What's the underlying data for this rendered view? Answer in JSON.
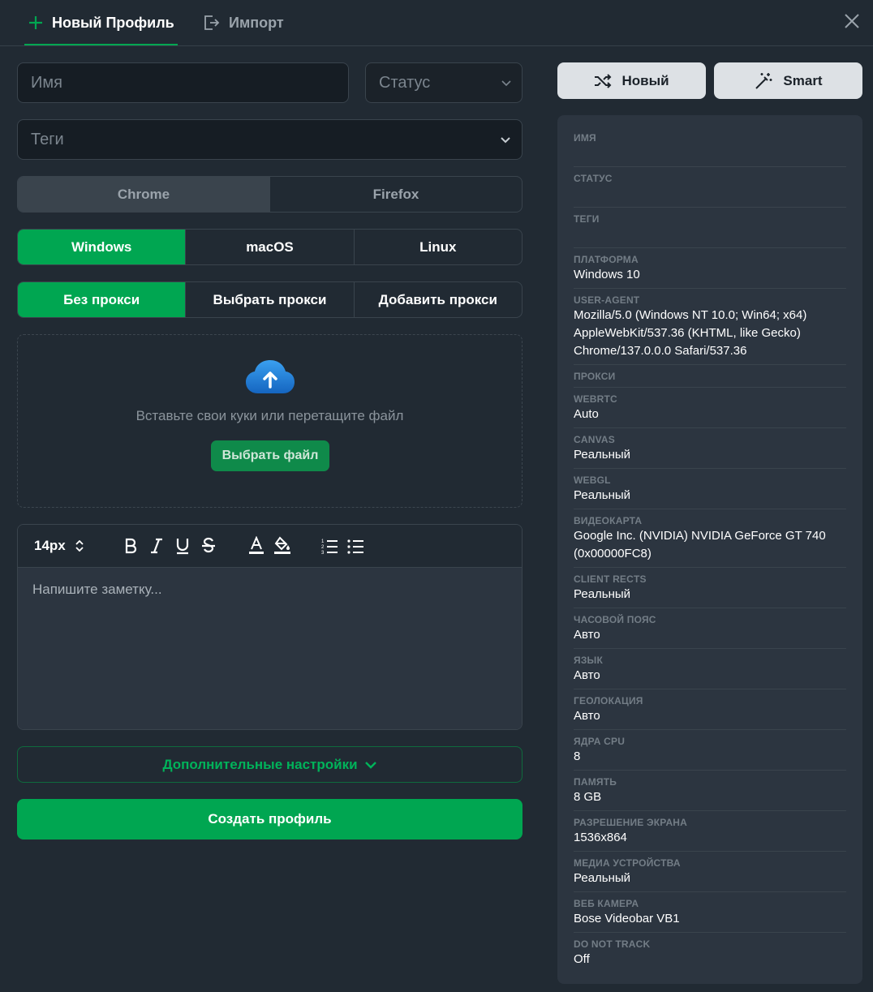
{
  "header": {
    "tab_new": "Новый Профиль",
    "tab_import": "Импорт"
  },
  "form": {
    "name_placeholder": "Имя",
    "status_placeholder": "Статус",
    "tags_placeholder": "Теги",
    "browsers": [
      "Chrome",
      "Firefox"
    ],
    "platforms": [
      "Windows",
      "macOS",
      "Linux"
    ],
    "proxy_options": [
      "Без прокси",
      "Выбрать прокси",
      "Добавить прокси"
    ],
    "cookies_hint": "Вставьте свои куки или перетащите файл",
    "pick_file": "Выбрать файл",
    "font_size": "14px",
    "note_placeholder": "Напишите заметку...",
    "more_settings": "Дополнительные настройки",
    "create": "Создать профиль"
  },
  "generate": {
    "new_label": "Новый",
    "smart_label": "Smart"
  },
  "summary": [
    {
      "label": "ИМЯ",
      "value": ""
    },
    {
      "label": "СТАТУС",
      "value": ""
    },
    {
      "label": "ТЕГИ",
      "value": ""
    },
    {
      "label": "ПЛАТФОРМА",
      "value": "Windows 10"
    },
    {
      "label": "USER-AGENT",
      "value": "Mozilla/5.0 (Windows NT 10.0; Win64; x64) AppleWebKit/537.36 (KHTML, like Gecko) Chrome/137.0.0.0 Safari/537.36"
    },
    {
      "label": "ПРОКСИ",
      "value": ""
    },
    {
      "label": "WEBRTC",
      "value": "Auto"
    },
    {
      "label": "CANVAS",
      "value": "Реальный"
    },
    {
      "label": "WEBGL",
      "value": "Реальный"
    },
    {
      "label": "ВИДЕОКАРТА",
      "value": "Google Inc. (NVIDIA) NVIDIA GeForce GT 740 (0x00000FC8)"
    },
    {
      "label": "CLIENT RECTS",
      "value": "Реальный"
    },
    {
      "label": "ЧАСОВОЙ ПОЯС",
      "value": "Авто"
    },
    {
      "label": "ЯЗЫК",
      "value": "Авто"
    },
    {
      "label": "ГЕОЛОКАЦИЯ",
      "value": "Авто"
    },
    {
      "label": "ЯДРА CPU",
      "value": "8"
    },
    {
      "label": "ПАМЯТЬ",
      "value": "8 GB"
    },
    {
      "label": "РАЗРЕШЕНИЕ ЭКРАНА",
      "value": "1536x864"
    },
    {
      "label": "МЕДИА УСТРОЙСТВА",
      "value": "Реальный"
    },
    {
      "label": "ВЕБ КАМЕРА",
      "value": "Bose Videobar VB1"
    },
    {
      "label": "DO NOT TRACK",
      "value": "Off"
    }
  ]
}
